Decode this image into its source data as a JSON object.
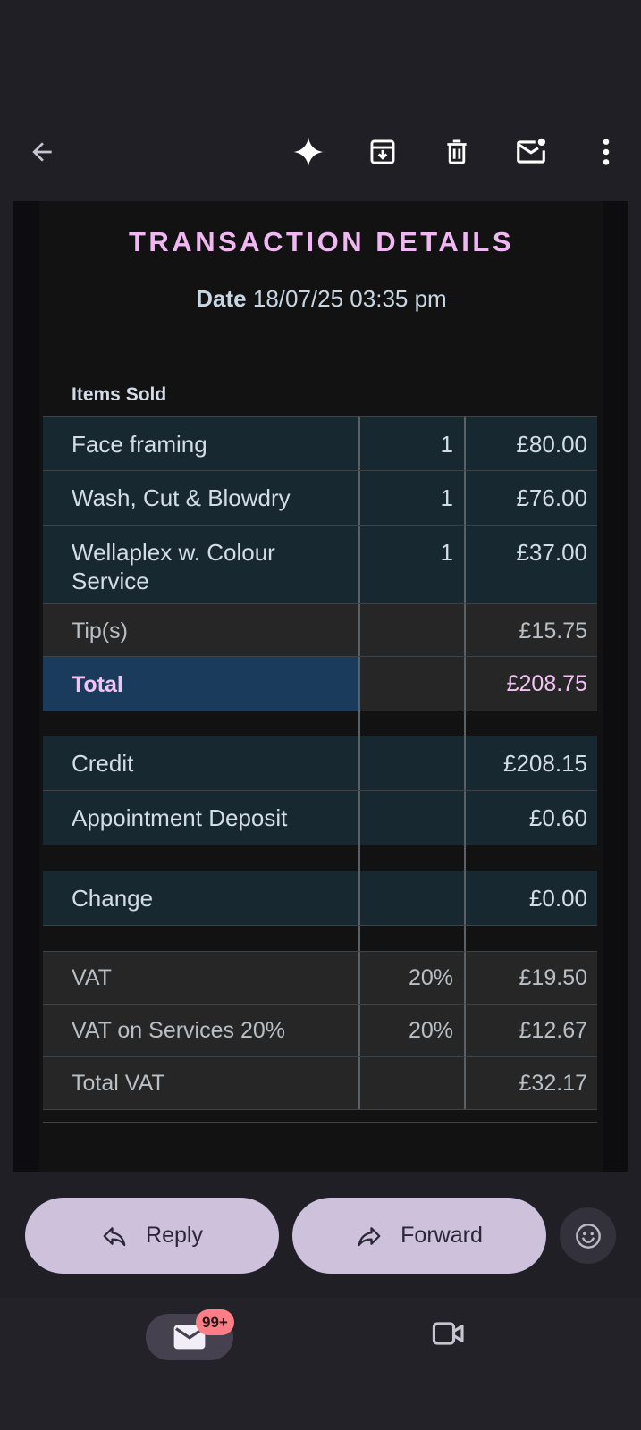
{
  "toolbar": {
    "icons": [
      "back-arrow-icon",
      "sparkle-icon",
      "archive-icon",
      "delete-icon",
      "mark-unread-icon",
      "more-vert-icon"
    ]
  },
  "email": {
    "title": "TRANSACTION DETAILS",
    "date_label": "Date",
    "date_value": "18/07/25 03:35 pm",
    "items_sold_label": "Items Sold",
    "items": [
      {
        "name": "Face framing",
        "qty": "1",
        "price": "£80.00"
      },
      {
        "name": "Wash, Cut & Blowdry",
        "qty": "1",
        "price": "£76.00"
      },
      {
        "name": "Wellaplex w. Colour Service",
        "qty": "1",
        "price": "£37.00"
      }
    ],
    "tips": {
      "label": "Tip(s)",
      "value": "£15.75"
    },
    "total": {
      "label": "Total",
      "value": "£208.75"
    },
    "payments": [
      {
        "label": "Credit",
        "value": "£208.15"
      },
      {
        "label": "Appointment Deposit",
        "value": "£0.60"
      }
    ],
    "change": {
      "label": "Change",
      "value": "£0.00"
    },
    "vat": [
      {
        "label": "VAT",
        "rate": "20%",
        "value": "£19.50"
      },
      {
        "label": "VAT on Services 20%",
        "rate": "20%",
        "value": "£12.67"
      },
      {
        "label": "Total VAT",
        "rate": "",
        "value": "£32.17"
      }
    ]
  },
  "actions": {
    "reply_label": "Reply",
    "forward_label": "Forward"
  },
  "bottom_nav": {
    "mail_badge": "99+"
  },
  "colors": {
    "title": "#f0b8f2",
    "item_row": "#182831",
    "grey_row": "#262626",
    "total_cell": "#1b3b5c",
    "pill": "#cdc1dc",
    "badge": "#ff7d86"
  }
}
